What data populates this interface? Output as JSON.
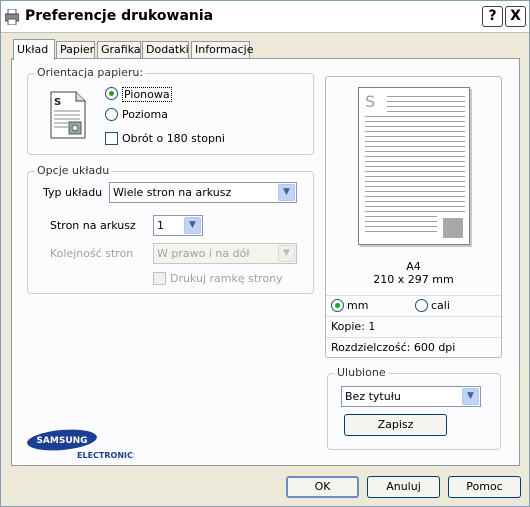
{
  "window": {
    "title": "Preferencje drukowania",
    "help_label": "?",
    "close_label": "X"
  },
  "tabs": [
    "Układ",
    "Papier",
    "Grafika",
    "Dodatki",
    "Informacje"
  ],
  "orientation": {
    "legend": "Orientacja papieru:",
    "portrait_label": "Pionowa",
    "landscape_label": "Pozioma",
    "rotate_label": "Obrót o 180 stopni",
    "selected": "Pionowa",
    "rotate_checked": false
  },
  "layout": {
    "legend": "Opcje układu",
    "type_label": "Typ układu",
    "type_value": "Wiele stron na arkusz",
    "pages_label": "Stron na arkusz",
    "pages_value": "1",
    "order_label": "Kolejność stron",
    "order_value": "W prawo i na dół",
    "border_label": "Drukuj ramkę strony"
  },
  "preview": {
    "page_letter": "S",
    "paper_name": "A4",
    "paper_size": "210 x 297 mm",
    "unit_mm": "mm",
    "unit_inch": "cali",
    "unit_selected": "mm",
    "copies": "Kopie: 1",
    "resolution": "Rozdzielczość: 600 dpi"
  },
  "favorites": {
    "legend": "Ulubione",
    "value": "Bez tytułu",
    "save_label": "Zapisz"
  },
  "brand": {
    "name": "SAMSUNG",
    "sub": "ELECTRONICS"
  },
  "buttons": {
    "ok": "OK",
    "cancel": "Anuluj",
    "help": "Pomoc"
  },
  "colors": {
    "accent_check": "#21a121",
    "brand_blue": "#1a3f95",
    "window_bg": "#ece9d8"
  }
}
